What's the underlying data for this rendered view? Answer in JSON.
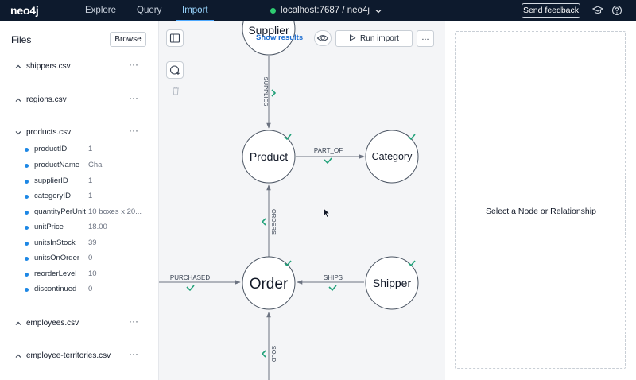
{
  "app": {
    "logo": "neo4j",
    "nav": [
      "Explore",
      "Query",
      "Import"
    ],
    "active_tab": "Import",
    "connection": "localhost:7687 / neo4j",
    "feedback_label": "Send feedback"
  },
  "files": {
    "title": "Files",
    "browse_label": "Browse",
    "list": [
      {
        "name": "shippers.csv",
        "expanded": false
      },
      {
        "name": "regions.csv",
        "expanded": false
      },
      {
        "name": "products.csv",
        "expanded": true
      },
      {
        "name": "employees.csv",
        "expanded": false
      },
      {
        "name": "employee-territories.csv",
        "expanded": false
      }
    ],
    "properties": [
      {
        "name": "productID",
        "value": "1"
      },
      {
        "name": "productName",
        "value": "Chai"
      },
      {
        "name": "supplierID",
        "value": "1"
      },
      {
        "name": "categoryID",
        "value": "1"
      },
      {
        "name": "quantityPerUnit",
        "value": "10 boxes x 20..."
      },
      {
        "name": "unitPrice",
        "value": "18.00"
      },
      {
        "name": "unitsInStock",
        "value": "39"
      },
      {
        "name": "unitsOnOrder",
        "value": "0"
      },
      {
        "name": "reorderLevel",
        "value": "10"
      },
      {
        "name": "discontinued",
        "value": "0"
      }
    ]
  },
  "canvas": {
    "show_results": "Show results",
    "run_import": "Run import",
    "more": "...",
    "nodes": {
      "supplier": "Supplier",
      "product": "Product",
      "category": "Category",
      "order": "Order",
      "shipper": "Shipper"
    },
    "relationships": {
      "supplies": "SUPPLIES",
      "part_of": "PART_OF",
      "orders": "ORDERS",
      "purchased": "PURCHASED",
      "ships": "SHIPS",
      "sold": "SOLD"
    }
  },
  "details": {
    "placeholder": "Select a Node or Relationship"
  },
  "colors": {
    "topbar": "#0d1a2d",
    "accent": "#4da9ff",
    "check": "#21a179",
    "property_dot": "#1e88e5"
  }
}
